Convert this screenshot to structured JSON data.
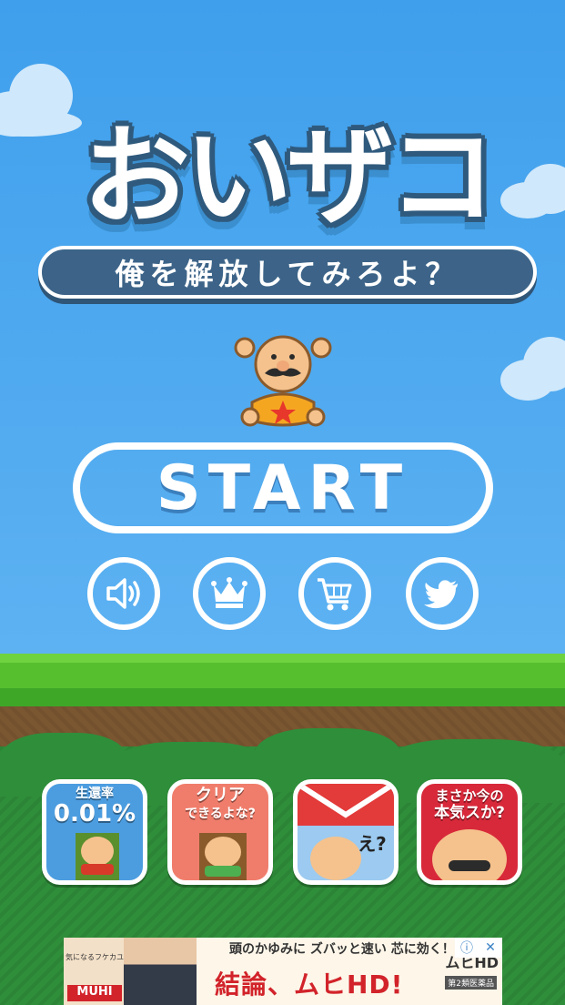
{
  "title": "おいザコ",
  "subtitle": "俺を解放してみろよ？",
  "start_label": "START",
  "menu_icons": [
    "speaker-icon",
    "crown-icon",
    "cart-icon",
    "bird-icon"
  ],
  "promos": [
    {
      "line1": "生還率",
      "line2": "0.01%",
      "bg": "#4c9de0"
    },
    {
      "line1": "クリア",
      "line2": "できるよな?",
      "bg": "#f07d6b"
    },
    {
      "line1": "",
      "line2": "え?",
      "bg": "#e33a3a"
    },
    {
      "line1": "まさか今の",
      "line2": "本気スか?",
      "bg": "#d8293a"
    }
  ],
  "ad": {
    "small_text": "気になるフケカユ",
    "brand_left": "MUHI",
    "line1": "頭のかゆみに ズバッと速い 芯に効く！",
    "line2": "結論、ムヒHD!",
    "brand_right": "ムヒHD",
    "class_label": "第2類医薬品",
    "info": "ⓘ",
    "close": "✕"
  },
  "colors": {
    "sky": "#4aa8ef",
    "banner": "#3d6488",
    "grass": "#56bf2e",
    "dirt": "#7a5631",
    "bush": "#2f8e3a"
  }
}
